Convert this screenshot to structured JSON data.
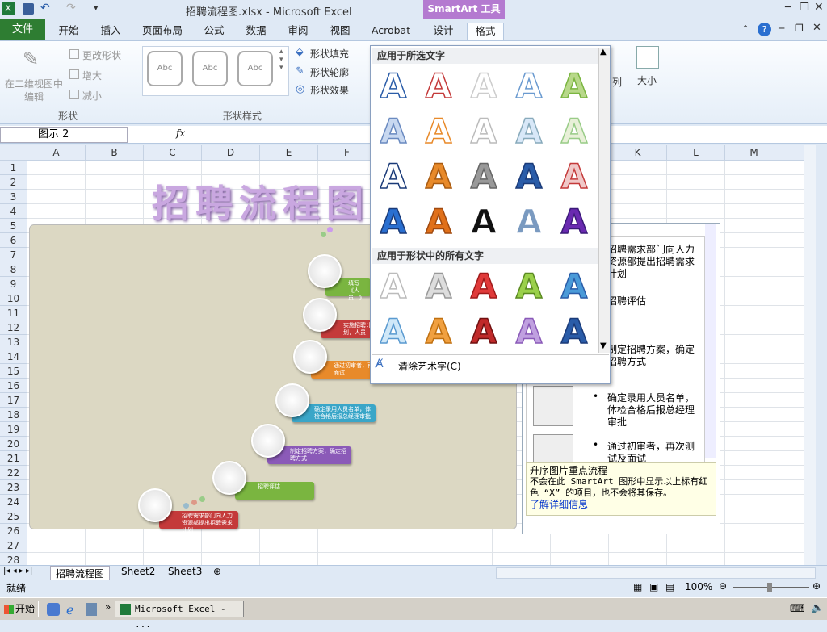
{
  "window": {
    "title": "招聘流程图.xlsx - Microsoft Excel",
    "context_tab": "SmartArt 工具"
  },
  "tabs": [
    "开始",
    "插入",
    "页面布局",
    "公式",
    "数据",
    "审阅",
    "视图",
    "Acrobat",
    "设计",
    "格式"
  ],
  "file_tab": "文件",
  "ribbon": {
    "shapes": {
      "edit_2d": "在二维视图中",
      "edit_2d_2": "编辑",
      "change_shape": "更改形状",
      "larger": "增大",
      "smaller": "减小",
      "group": "形状"
    },
    "shape_styles": {
      "style_label": "Abc",
      "fill": "形状填充",
      "outline": "形状轮廓",
      "effects": "形状效果",
      "group": "形状样式"
    },
    "right": {
      "size": "大小",
      "arrange_frag": "列"
    }
  },
  "formula": {
    "namebox": "图示 2",
    "fx": "fx"
  },
  "columns": [
    "A",
    "B",
    "C",
    "D",
    "E",
    "F",
    "G",
    "H",
    "I",
    "J",
    "K",
    "L",
    "M",
    "N"
  ],
  "rows": [
    "1",
    "2",
    "3",
    "4",
    "5",
    "6",
    "7",
    "8",
    "9",
    "10",
    "11",
    "12",
    "13",
    "14",
    "15",
    "16",
    "17",
    "18",
    "19",
    "20",
    "21",
    "22",
    "23",
    "24",
    "25",
    "26",
    "27",
    "28"
  ],
  "wordart_title": "招聘流程图",
  "steps": [
    "填写《人员...》",
    "实施招聘计划，人员",
    "通过初审者，再次面试",
    "确定录用人员名单，体检合格后报总经理审批",
    "制定招聘方案，确定招聘方式",
    "招聘评估",
    "招聘需求部门向人力资源部提出招聘需求计划"
  ],
  "gallery": {
    "section1": "应用于所选文字",
    "section2": "应用于形状中的所有文字",
    "glyph": "A",
    "clear": "清除艺术字(C)"
  },
  "textpane": {
    "items": [
      "招聘需求部门向人力资源部提出招聘需求计划",
      "招聘评估",
      "制定招聘方案，确定招聘方式",
      "确定录用人员名单，体检合格后报总经理审批",
      "通过初审者，再次测试及面试"
    ],
    "items_frag": [
      "招聘需求部门向人力",
      "资源部提出招聘需求",
      "计划",
      "招聘评估",
      "制定招聘方案，确定",
      "招聘方式",
      "确定录用人员名单，",
      "体检合格后报总经理",
      "审批",
      "通过初审者，再次测",
      "试及面试"
    ],
    "layout_name": "升序图片重点流程",
    "desc": "不会在此 SmartArt 图形中显示以上标有红色 “X” 的项目，也不会将其保存。",
    "link": "了解详细信息"
  },
  "sheets": [
    "招聘流程图",
    "Sheet2",
    "Sheet3"
  ],
  "status": {
    "ready": "就绪",
    "zoom": "100%"
  },
  "taskbar": {
    "start": "开始",
    "app": "Microsoft Excel - ..."
  }
}
